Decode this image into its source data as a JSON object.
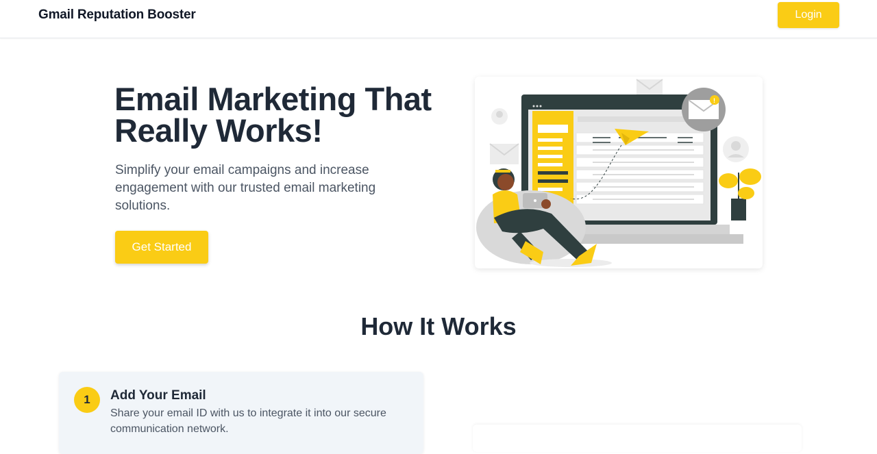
{
  "header": {
    "brand": "Gmail Reputation Booster",
    "login_label": "Login"
  },
  "hero": {
    "title_line1": "Email Marketing That",
    "title_line2": "Really Works!",
    "subtitle": "Simplify your email campaigns and increase engagement with our trusted email marketing solutions.",
    "cta_label": "Get Started",
    "illustration_icon": "email-marketing-illustration"
  },
  "how_it_works": {
    "title": "How It Works",
    "steps": [
      {
        "number": "1",
        "title": "Add Your Email",
        "description": "Share your email ID with us to integrate it into our secure communication network."
      }
    ]
  },
  "colors": {
    "accent": "#facc15",
    "heading": "#1f2937",
    "body_text": "#4b5563",
    "card_bg": "#f1f5f9"
  }
}
